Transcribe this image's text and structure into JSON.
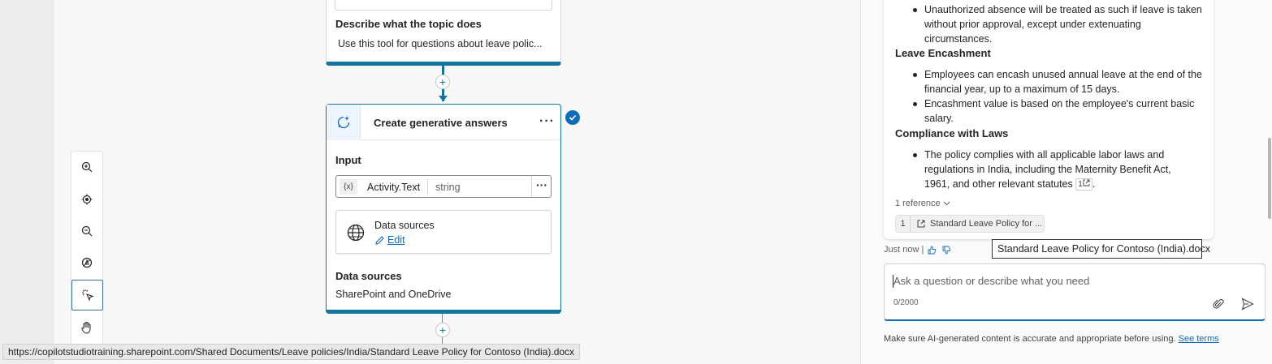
{
  "canvas": {
    "top_card": {
      "describe_label": "Describe what the topic does",
      "describe_value": "Use this tool for questions about leave polic..."
    },
    "gen_card": {
      "title": "Create generative answers",
      "more": "···",
      "input_label": "Input",
      "variable_badge": "{x}",
      "variable_name": "Activity.Text",
      "variable_type": "string",
      "variable_more": "···",
      "data_sources_title": "Data sources",
      "data_sources_edit": "Edit",
      "data_sources_label": "Data sources",
      "data_sources_value": "SharePoint and OneDrive"
    },
    "plus": "+",
    "zoom_tools": [
      "zoom-in-icon",
      "locate-icon",
      "zoom-out-icon",
      "minimap-icon",
      "select-icon",
      "pan-hand-icon"
    ]
  },
  "status_url": "https://copilotstudiotraining.sharepoint.com/Shared Documents/Leave policies/India/Standard Leave Policy for Contoso (India).docx",
  "chat": {
    "bullets_top": [
      "Unauthorized absence will be treated as such if leave is taken",
      "without prior approval, except under extenuating",
      "circumstances."
    ],
    "section_encashment": "Leave Encashment",
    "encash_1": [
      "Employees can encash unused annual leave at the end of the",
      "financial year, up to a maximum of 15 days."
    ],
    "encash_2": [
      "Encashment value is based on the employee's current basic",
      "salary."
    ],
    "section_compliance": "Compliance with Laws",
    "compliance_1": [
      "The policy complies with all applicable labor laws and",
      "regulations in India, including the Maternity Benefit Act,",
      "1961, and other relevant statutes"
    ],
    "compliance_cite": "1",
    "compliance_end": ".",
    "references_toggle": "1 reference",
    "reference_num": "1",
    "reference_label": "Standard Leave Policy for ...",
    "tooltip": "Standard Leave Policy for Contoso (India).docx",
    "timestamp": "Just now",
    "input_placeholder": "Ask a question or describe what you need",
    "counter": "0/2000",
    "disclaimer": "Make sure AI-generated content is accurate and appropriate before using.",
    "see_terms": "See terms"
  },
  "colors": {
    "accent": "#11759f",
    "link": "#0f6cbd"
  }
}
